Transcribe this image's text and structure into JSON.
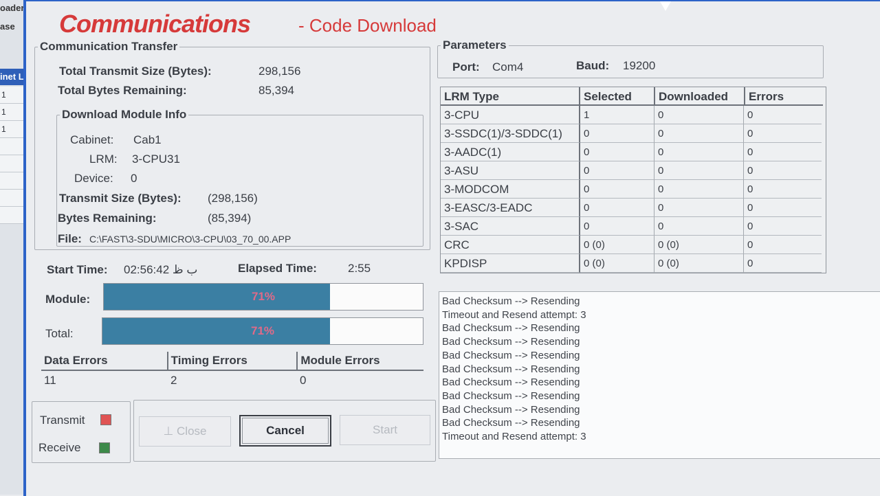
{
  "background_window": {
    "title_fragment": "oader Co",
    "title_fragment2": "ase",
    "column_header": "inet Lab",
    "rows": [
      "1",
      "1",
      "1"
    ]
  },
  "header": {
    "title": "Communications",
    "subtitle": "- Code Download"
  },
  "communication_transfer": {
    "legend": "Communication Transfer",
    "total_transmit_label": "Total Transmit Size (Bytes):",
    "total_transmit_value": "298,156",
    "total_remaining_label": "Total Bytes Remaining:",
    "total_remaining_value": "85,394"
  },
  "module_info": {
    "legend": "Download Module Info",
    "cabinet_label": "Cabinet:",
    "cabinet_value": "Cab1",
    "lrm_label": "LRM:",
    "lrm_value": "3-CPU31",
    "device_label": "Device:",
    "device_value": "0",
    "transmit_label": "Transmit Size (Bytes):",
    "transmit_value": "(298,156)",
    "remaining_label": "Bytes Remaining:",
    "remaining_value": "(85,394)",
    "file_label": "File:",
    "file_value": "C:\\FAST\\3-SDU\\MICRO\\3-CPU\\03_70_00.APP"
  },
  "timing": {
    "start_label": "Start Time:",
    "start_value": "02:56:42 ب ظ",
    "elapsed_label": "Elapsed Time:",
    "elapsed_value": "2:55"
  },
  "progress": {
    "module_label": "Module:",
    "module_text": "71%",
    "module_fraction": 0.71,
    "total_label": "Total:",
    "total_text": "71%",
    "total_fraction": 0.71
  },
  "errors": {
    "headers": [
      "Data Errors",
      "Timing Errors",
      "Module Errors"
    ],
    "values": [
      "11",
      "2",
      "0"
    ]
  },
  "indicators": {
    "transmit_label": "Transmit",
    "transmit_color": "#e05454",
    "receive_label": "Receive",
    "receive_color": "#3d8a4a"
  },
  "buttons": {
    "close": "Close",
    "cancel": "Cancel",
    "start": "Start"
  },
  "parameters": {
    "legend": "Parameters",
    "port_label": "Port:",
    "port_value": "Com4",
    "baud_label": "Baud:",
    "baud_value": "19200"
  },
  "lrm_table": {
    "headers": [
      "LRM Type",
      "Selected",
      "Downloaded",
      "Errors"
    ],
    "rows": [
      [
        "3-CPU",
        "1",
        "0",
        "0"
      ],
      [
        "3-SSDC(1)/3-SDDC(1)",
        "0",
        "0",
        "0"
      ],
      [
        "3-AADC(1)",
        "0",
        "0",
        "0"
      ],
      [
        "3-ASU",
        "0",
        "0",
        "0"
      ],
      [
        "3-MODCOM",
        "0",
        "0",
        "0"
      ],
      [
        "3-EASC/3-EADC",
        "0",
        "0",
        "0"
      ],
      [
        "3-SAC",
        "0",
        "0",
        "0"
      ],
      [
        "CRC",
        "0 (0)",
        "0 (0)",
        "0"
      ],
      [
        "KPDISP",
        "0 (0)",
        "0 (0)",
        "0"
      ]
    ]
  },
  "log": [
    "Bad Checksum --> Resending",
    "Timeout and Resend attempt: 3",
    "Bad Checksum --> Resending",
    "Bad Checksum --> Resending",
    "Bad Checksum --> Resending",
    "Bad Checksum --> Resending",
    "Bad Checksum --> Resending",
    "Bad Checksum --> Resending",
    "Bad Checksum --> Resending",
    "Bad Checksum --> Resending",
    "Timeout and Resend attempt: 3"
  ]
}
